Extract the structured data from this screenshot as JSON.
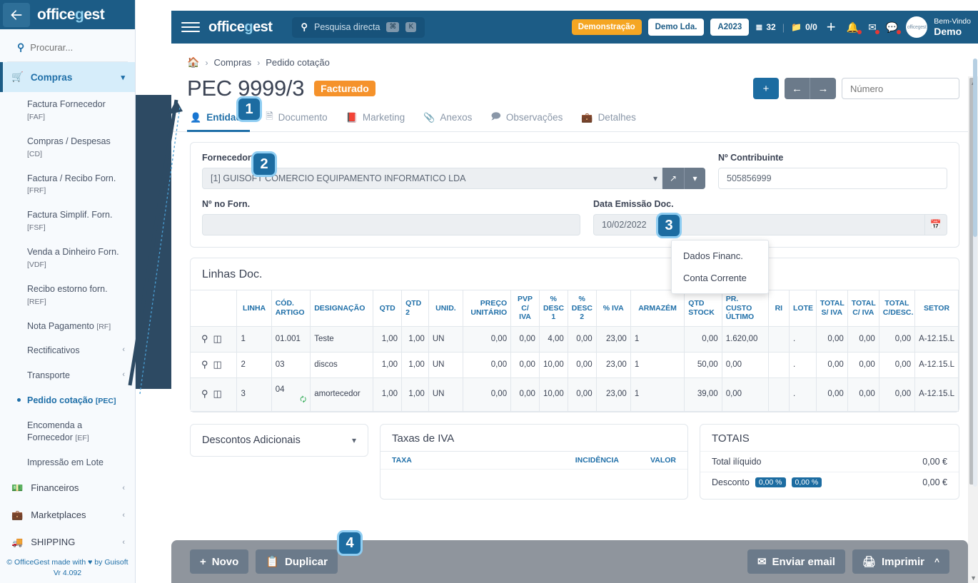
{
  "sidebar": {
    "back_icon": "arrow-left-icon",
    "logo": "officegest",
    "search_placeholder": "Procurar...",
    "group": {
      "label": "Compras",
      "icon": "cart-icon",
      "chevron": "ⱟ"
    },
    "items": [
      {
        "label": "Factura Fornecedor",
        "code": "[FAF]"
      },
      {
        "label": "Compras / Despesas",
        "code": "[CD]"
      },
      {
        "label": "Factura / Recibo Forn.",
        "code": "[FRF]"
      },
      {
        "label": "Factura Simplif. Forn.",
        "code": "[FSF]"
      },
      {
        "label": "Venda a Dinheiro Forn.",
        "code": "[VDF]"
      },
      {
        "label": "Recibo estorno forn.",
        "code": "[REF]"
      },
      {
        "label": "Nota Pagamento",
        "code": "[RF]"
      },
      {
        "label": "Rectificativos",
        "code": "",
        "arrow": "‹"
      },
      {
        "label": "Transporte",
        "code": "",
        "arrow": "‹"
      },
      {
        "label": "Pedido cotação",
        "code": "[PEC]",
        "active": true
      },
      {
        "label": "Encomenda a Fornecedor",
        "code": "[EF]"
      },
      {
        "label": "Impressão em Lote",
        "code": ""
      }
    ],
    "bottom_items": [
      {
        "label": "Financeiros",
        "icon": "money-icon",
        "arrow": "‹"
      },
      {
        "label": "Marketplaces",
        "icon": "bag-icon",
        "arrow": "‹"
      },
      {
        "label": "SHIPPING",
        "icon": "truck-icon",
        "arrow": "‹"
      }
    ],
    "footer_line1_pre": "© OfficeGest made with ",
    "footer_heart": "♥",
    "footer_line1_post": " by Guisoft",
    "footer_version": "Vr 4.092"
  },
  "topbar": {
    "menu_icon": "hamburger-icon",
    "logo": "officegest",
    "search_placeholder": "Pesquisa directa",
    "kbd1": "⌘",
    "kbd2": "K",
    "demo_badge": "Demonstração",
    "company": "Demo Lda.",
    "year": "A2023",
    "tasks_icon": "tasks-icon",
    "tasks_count": "32",
    "folder_icon": "folder-icon",
    "folder_count": "0/0",
    "plus": "+",
    "bell_icon": "bell-icon",
    "mail_icon": "mail-icon",
    "chat_icon": "chat-icon",
    "avatar_text": "officegest",
    "welcome_small": "Bem-Vindo",
    "welcome_big": "Demo"
  },
  "breadcrumb": {
    "home_icon": "home-icon",
    "sep": "›",
    "level1": "Compras",
    "level2": "Pedido cotação"
  },
  "page": {
    "title": "PEC 9999/3",
    "status": "Facturado",
    "add_label": "+",
    "prev_label": "←",
    "next_label": "→",
    "numero_placeholder": "Número"
  },
  "tabs": [
    {
      "label": "Entidade",
      "icon": "user-icon",
      "active": true
    },
    {
      "label": "Documento",
      "icon": "document-icon",
      "active": false
    },
    {
      "label": "Marketing",
      "icon": "book-icon",
      "active": false
    },
    {
      "label": "Anexos",
      "icon": "paperclip-icon",
      "active": false
    },
    {
      "label": "Observações",
      "icon": "comment-icon",
      "active": false
    },
    {
      "label": "Detalhes",
      "icon": "briefcase-icon",
      "active": false
    }
  ],
  "form": {
    "fornecedor_label": "Fornecedor",
    "fornecedor_required": "*",
    "fornecedor_value": "[1] GUISOFT COMERCIO EQUIPAMENTO INFORMATICO LDA",
    "fornecedor_chevron": "ⱟ",
    "open_icon": "external-link-icon",
    "dropdown_icon": "chevron-down-icon",
    "contribuinte_label": "Nº Contribuinte",
    "contribuinte_value": "505856999",
    "nforn_label": "Nº no Forn.",
    "nforn_value": "",
    "data_label": "Data Emissão Doc.",
    "data_value": "10/02/2022",
    "calendar_icon": "calendar-icon"
  },
  "dropdown_menu": {
    "items": [
      "Dados Financ.",
      "Conta Corrente"
    ]
  },
  "linhas": {
    "title": "Linhas Doc.",
    "headers": [
      "",
      "LINHA",
      "CÓD. ARTIGO",
      "DESIGNAÇÃO",
      "QTD",
      "QTD 2",
      "UNID.",
      "PREÇO UNITÁRIO",
      "PVP C/ IVA",
      "% DESC 1",
      "% DESC 2",
      "% IVA",
      "ARMAZÉM",
      "QTD STOCK",
      "PR. CUSTO ÚLTIMO",
      "RI",
      "LOTE",
      "TOTAL S/ IVA",
      "TOTAL C/ IVA",
      "TOTAL C/DESC.",
      "SETOR"
    ],
    "row_icons": [
      "search-icon",
      "box-icon"
    ],
    "rows": [
      {
        "linha": "1",
        "cod": "01.001",
        "designacao": "Teste",
        "qtd": "1,00",
        "qtd2": "1,00",
        "unid": "UN",
        "preco": "0,00",
        "pvp": "0,00",
        "desc1": "4,00",
        "desc2": "0,00",
        "iva": "23,00",
        "armazem": "1",
        "qtdstock": "0,00",
        "prcusto": "1.620,00",
        "ri": "",
        "lote": ".",
        "tsiva": "0,00",
        "tciva": "0,00",
        "tcdesc": "0,00",
        "setor": "A-12.15.L",
        "sub_icon": ""
      },
      {
        "linha": "2",
        "cod": "03",
        "designacao": "discos",
        "qtd": "1,00",
        "qtd2": "1,00",
        "unid": "UN",
        "preco": "0,00",
        "pvp": "0,00",
        "desc1": "10,00",
        "desc2": "0,00",
        "iva": "23,00",
        "armazem": "1",
        "qtdstock": "50,00",
        "prcusto": "0,00",
        "ri": "",
        "lote": ".",
        "tsiva": "0,00",
        "tciva": "0,00",
        "tcdesc": "0,00",
        "setor": "A-12.15.L",
        "sub_icon": ""
      },
      {
        "linha": "3",
        "cod": "04",
        "designacao": "amortecedor",
        "qtd": "1,00",
        "qtd2": "1,00",
        "unid": "UN",
        "preco": "0,00",
        "pvp": "0,00",
        "desc1": "10,00",
        "desc2": "0,00",
        "iva": "23,00",
        "armazem": "1",
        "qtdstock": "39,00",
        "prcusto": "0,00",
        "ri": "",
        "lote": ".",
        "tsiva": "0,00",
        "tciva": "0,00",
        "tcdesc": "0,00",
        "setor": "A-12.15.L",
        "sub_icon": "swap-icon"
      }
    ]
  },
  "descontos": {
    "label": "Descontos Adicionais",
    "chevron": "ⱟ"
  },
  "iva_panel": {
    "title": "Taxas de IVA",
    "col_taxa": "TAXA",
    "col_incidencia": "INCIDÊNCIA",
    "col_valor": "VALOR"
  },
  "totais_panel": {
    "title": "TOTAIS",
    "row1_label": "Total ilíquido",
    "row1_value": "0,00 €",
    "row2_label": "Desconto",
    "row2_tag1": "0,00 %",
    "row2_tag2": "0,00 %",
    "row2_value": "0,00 €"
  },
  "actionbar": {
    "novo": "Novo",
    "novo_icon": "plus-icon",
    "duplicar": "Duplicar",
    "duplicar_icon": "copy-icon",
    "enviar_email": "Enviar email",
    "email_icon": "mail-icon",
    "imprimir": "Imprimir",
    "print_icon": "printer-icon",
    "caret_up": "^"
  },
  "annotations": {
    "badge1": "1",
    "badge2": "2",
    "badge3": "3",
    "badge4": "4"
  }
}
